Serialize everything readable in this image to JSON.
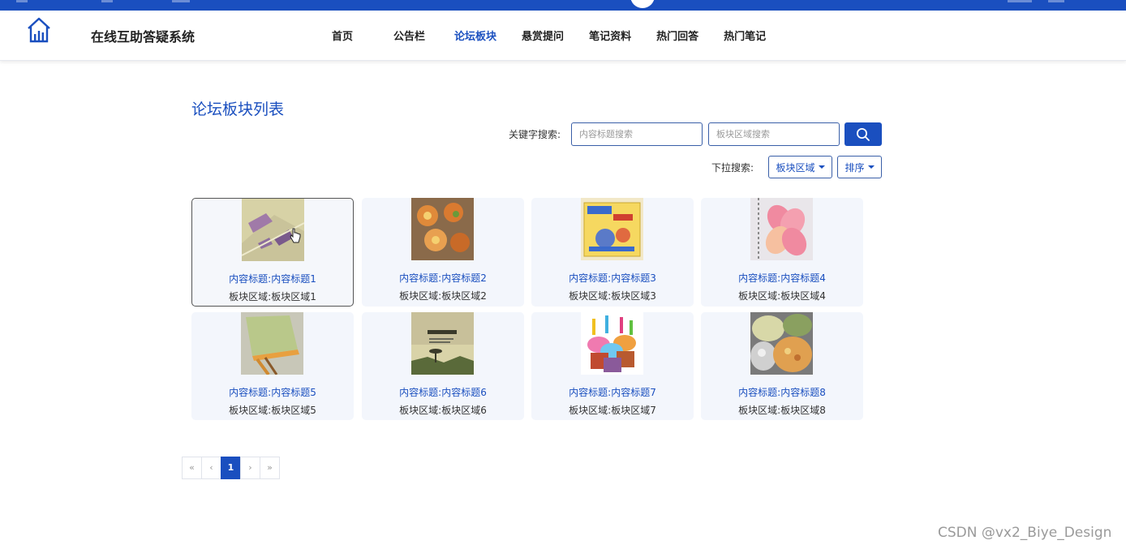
{
  "brand": {
    "title": "在线互助答疑系统",
    "accent": "#1a4fbf"
  },
  "nav": {
    "items": [
      "首页",
      "公告栏",
      "论坛板块",
      "悬赏提问",
      "笔记资料",
      "热门回答",
      "热门笔记"
    ],
    "active": "论坛板块"
  },
  "page": {
    "title": "论坛板块列表"
  },
  "search": {
    "keyword_label": "关键字搜索:",
    "title_placeholder": "内容标题搜索",
    "area_placeholder": "板块区域搜索",
    "button_icon": "search-icon"
  },
  "dropdown": {
    "label": "下拉搜索:",
    "area_label": "板块区域",
    "sort_label": "排序"
  },
  "cards": [
    {
      "title": "内容标题:内容标题1",
      "area": "板块区域:板块区域1"
    },
    {
      "title": "内容标题:内容标题2",
      "area": "板块区域:板块区域2"
    },
    {
      "title": "内容标题:内容标题3",
      "area": "板块区域:板块区域3"
    },
    {
      "title": "内容标题:内容标题4",
      "area": "板块区域:板块区域4"
    },
    {
      "title": "内容标题:内容标题5",
      "area": "板块区域:板块区域5"
    },
    {
      "title": "内容标题:内容标题6",
      "area": "板块区域:板块区域6"
    },
    {
      "title": "内容标题:内容标题7",
      "area": "板块区域:板块区域7"
    },
    {
      "title": "内容标题:内容标题8",
      "area": "板块区域:板块区域8"
    }
  ],
  "pagination": {
    "first": "«",
    "prev": "‹",
    "current": "1",
    "next": "›",
    "last": "»"
  },
  "watermark": "CSDN @vx2_Biye_Design"
}
